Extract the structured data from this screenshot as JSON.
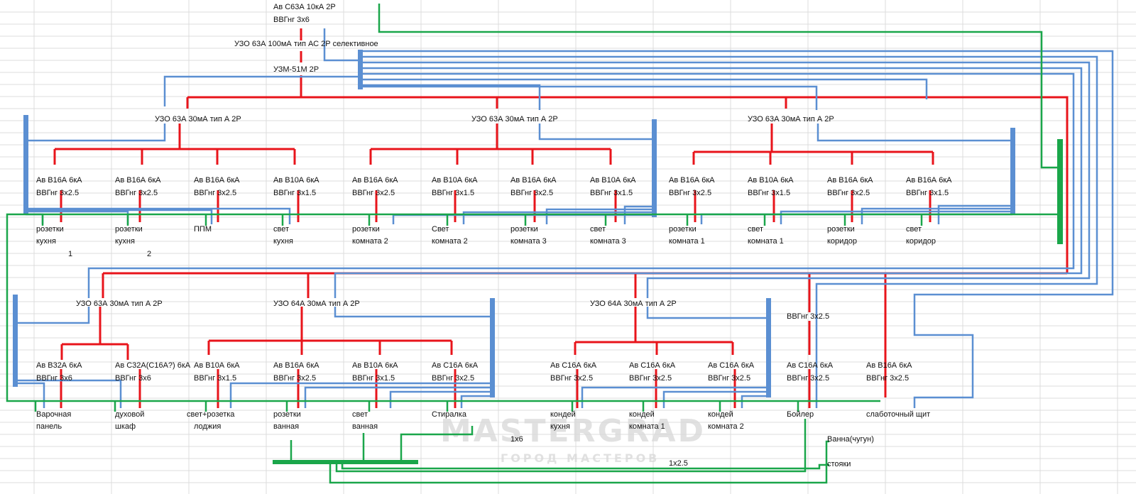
{
  "main": {
    "label": "Ав С63А 10кА 2Р",
    "cable": "ВВГнг   3х6",
    "rcd": "УЗО 63А 100мА тип АС 2Р селективное",
    "relay": "УЗМ-51М 2Р"
  },
  "groups": [
    {
      "rcd": "УЗО 63А 30мА тип А 2Р",
      "circuits": [
        {
          "breaker": "Ав В16А 6кА",
          "cable": "ВВГнг  3х2.5",
          "load1": "розетки",
          "load2": "кухня",
          "note": "1"
        },
        {
          "breaker": "Ав В16А 6кА",
          "cable": "ВВГнг  3х2.5",
          "load1": "розетки",
          "load2": "кухня",
          "note": "2"
        },
        {
          "breaker": "Ав В16А 6кА",
          "cable": "ВВГнг  3х2.5",
          "load1": "ППМ",
          "load2": ""
        },
        {
          "breaker": "Ав В10А 6кА",
          "cable": "ВВГнг  3х1.5",
          "load1": "свет",
          "load2": "кухня"
        }
      ]
    },
    {
      "rcd": "УЗО 63А 30мА тип А 2Р",
      "circuits": [
        {
          "breaker": "Ав В16А 6кА",
          "cable": "ВВГнг  3х2.5",
          "load1": "розетки",
          "load2": "комната 2"
        },
        {
          "breaker": "Ав В10А 6кА",
          "cable": "ВВГнг  3х1.5",
          "load1": "Свет",
          "load2": "комната 2"
        },
        {
          "breaker": "Ав В16А 6кА",
          "cable": "ВВГнг  3х2.5",
          "load1": "розетки",
          "load2": "комната 3"
        },
        {
          "breaker": "Ав В10А 6кА",
          "cable": "ВВГнг  3х1.5",
          "load1": "свет",
          "load2": "комната 3"
        }
      ]
    },
    {
      "rcd": "УЗО 63А 30мА тип А 2Р",
      "circuits": [
        {
          "breaker": "Ав В16А 6кА",
          "cable": "ВВГнг  3х2.5",
          "load1": "розетки",
          "load2": "комната 1"
        },
        {
          "breaker": "Ав В10А 6кА",
          "cable": "ВВГнг  3х1.5",
          "load1": "свет",
          "load2": "комната 1"
        },
        {
          "breaker": "Ав В16А 6кА",
          "cable": "ВВГнг  3х2.5",
          "load1": "розетки",
          "load2": "коридор"
        },
        {
          "breaker": "Ав В16А 6кА",
          "cable": "ВВГнг  3х1.5",
          "load1": "свет",
          "load2": "коридор"
        }
      ]
    },
    {
      "rcd": "УЗО 63А 30мА тип А 2Р",
      "circuits": [
        {
          "breaker": "Ав В32А 6кА",
          "cable": "ВВГнг  3х6",
          "load1": "Варочная",
          "load2": "панель"
        },
        {
          "breaker": "Ав С32А(С16А?) 6кА",
          "cable": "ВВГнг  3х6",
          "load1": "духовой",
          "load2": "шкаф"
        }
      ]
    },
    {
      "rcd": "УЗО 64А 30мА тип А 2Р",
      "circuits": [
        {
          "breaker": "Ав В10А 6кА",
          "cable": "ВВГнг  3х1.5",
          "load1": "свет+розетка",
          "load2": "лоджия"
        },
        {
          "breaker": "Ав В16А 6кА",
          "cable": "ВВГнг  3х2.5",
          "load1": "розетки",
          "load2": "ванная"
        },
        {
          "breaker": "Ав В10А 6кА",
          "cable": "ВВГнг  3х1.5",
          "load1": "свет",
          "load2": "ванная"
        },
        {
          "breaker": "Ав С16А 6кА",
          "cable": "ВВГнг  3х2.5",
          "load1": "Стиралка",
          "load2": ""
        }
      ]
    },
    {
      "rcd": "УЗО 64А 30мА тип А 2Р",
      "circuits": [
        {
          "breaker": "Ав С16А 6кА",
          "cable": "ВВГнг  3х2.5",
          "load1": "кондей",
          "load2": "кухня"
        },
        {
          "breaker": "Ав С16А 6кА",
          "cable": "ВВГнг  3х2.5",
          "load1": "кондей",
          "load2": "комната 1"
        },
        {
          "breaker": "Ав С16А 6кА",
          "cable": "ВВГнг  3х2.5",
          "load1": "кондей",
          "load2": "комната 2"
        }
      ]
    }
  ],
  "extra": {
    "boiler_feed_cable": "ВВГнг   3х2.5",
    "boiler": {
      "breaker": "Ав С16А 6кА",
      "cable": "ВВГнг  3х2.5",
      "load": "Бойлер"
    },
    "lowcurrent": {
      "breaker": "Ав В16А 6кА",
      "cable": "ВВГнг   3х2.5",
      "load": "слаботочный щит"
    }
  },
  "grounding": {
    "cable1": "1х6",
    "cable2": "1х2.5",
    "bath": "Ванна(чугун)",
    "risers": "стояки"
  },
  "watermark": {
    "line1": "MASTERGRAD",
    "line2": "ГОРОД МАСТЕРОВ"
  },
  "colors": {
    "phase": "#e8141b",
    "neutral": "#5b8fd2",
    "earth": "#1aa64a"
  }
}
